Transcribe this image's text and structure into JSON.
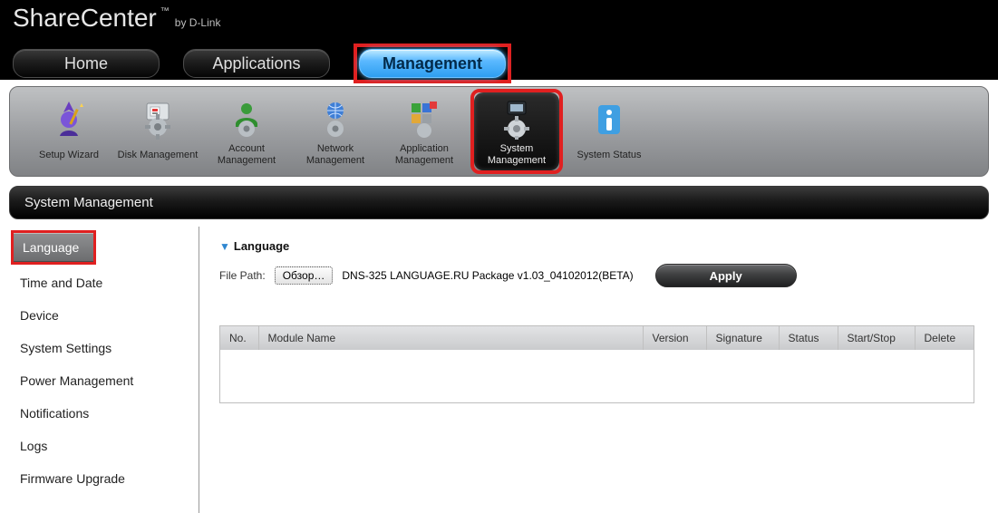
{
  "brand": {
    "title": "ShareCenter",
    "tm": "™",
    "by": "by D-Link"
  },
  "nav": {
    "home": "Home",
    "applications": "Applications",
    "management": "Management"
  },
  "toolbar": {
    "items": [
      {
        "label": "Setup Wizard"
      },
      {
        "label": "Disk Management"
      },
      {
        "label": "Account Management"
      },
      {
        "label": "Network Management"
      },
      {
        "label": "Application Management"
      },
      {
        "label": "System Management"
      },
      {
        "label": "System Status"
      }
    ]
  },
  "section_title": "System Management",
  "sidebar": {
    "items": [
      "Language",
      "Time and Date",
      "Device",
      "System Settings",
      "Power Management",
      "Notifications",
      "Logs",
      "Firmware Upgrade"
    ]
  },
  "panel": {
    "heading": "Language",
    "file_label": "File Path:",
    "browse": "Обзор…",
    "file_value": "DNS-325 LANGUAGE.RU Package v1.03_04102012(BETA)",
    "apply": "Apply"
  },
  "table": {
    "headers": {
      "no": "No.",
      "module": "Module Name",
      "version": "Version",
      "signature": "Signature",
      "status": "Status",
      "startstop": "Start/Stop",
      "delete": "Delete"
    }
  }
}
